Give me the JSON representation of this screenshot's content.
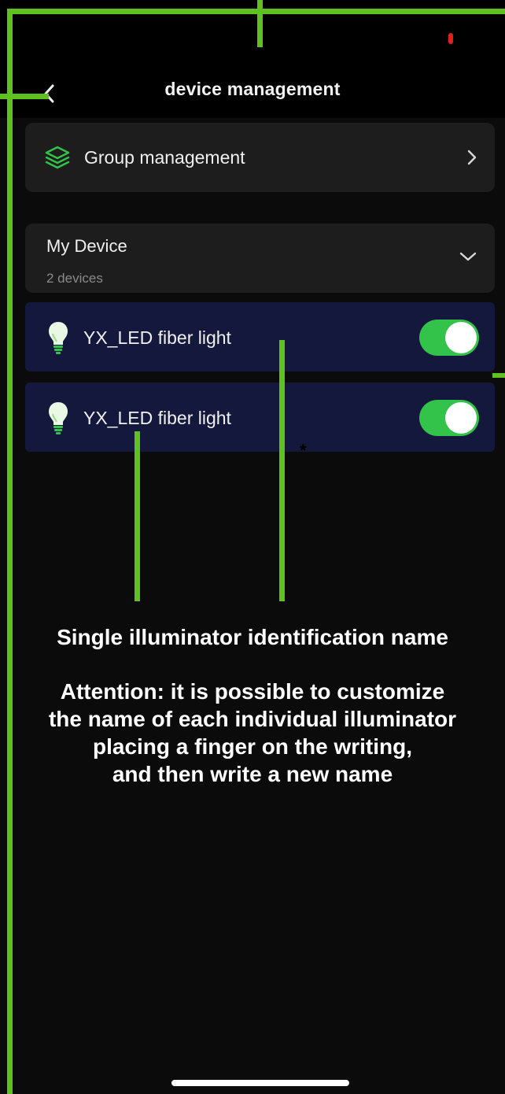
{
  "header": {
    "title": "device management",
    "back_icon": "chevron-left-icon"
  },
  "status_bar": {
    "indicator_color": "#e0211b"
  },
  "group_management": {
    "label": "Group management",
    "icon": "layers-icon",
    "icon_color": "#33c24a",
    "chevron_icon": "chevron-right-icon"
  },
  "my_device": {
    "title": "My Device",
    "count": "2 devices",
    "chevron_icon": "chevron-down-icon"
  },
  "devices": [
    {
      "name": "YX_LED fiber light",
      "icon": "lightbulb-icon",
      "on": true
    },
    {
      "name": "YX_LED fiber light",
      "icon": "lightbulb-icon",
      "on": true
    }
  ],
  "colors": {
    "toggle_on": "#33c24a",
    "annotation": "#5fc11f",
    "device_row_bg": "#15183d"
  },
  "annotation": {
    "heading": "Single illuminator identification name",
    "body": "Attention: it is possible to customize\nthe name of each individual illuminator\nplacing a finger on the writing,\nand then write a new name",
    "asterisk": "*"
  }
}
